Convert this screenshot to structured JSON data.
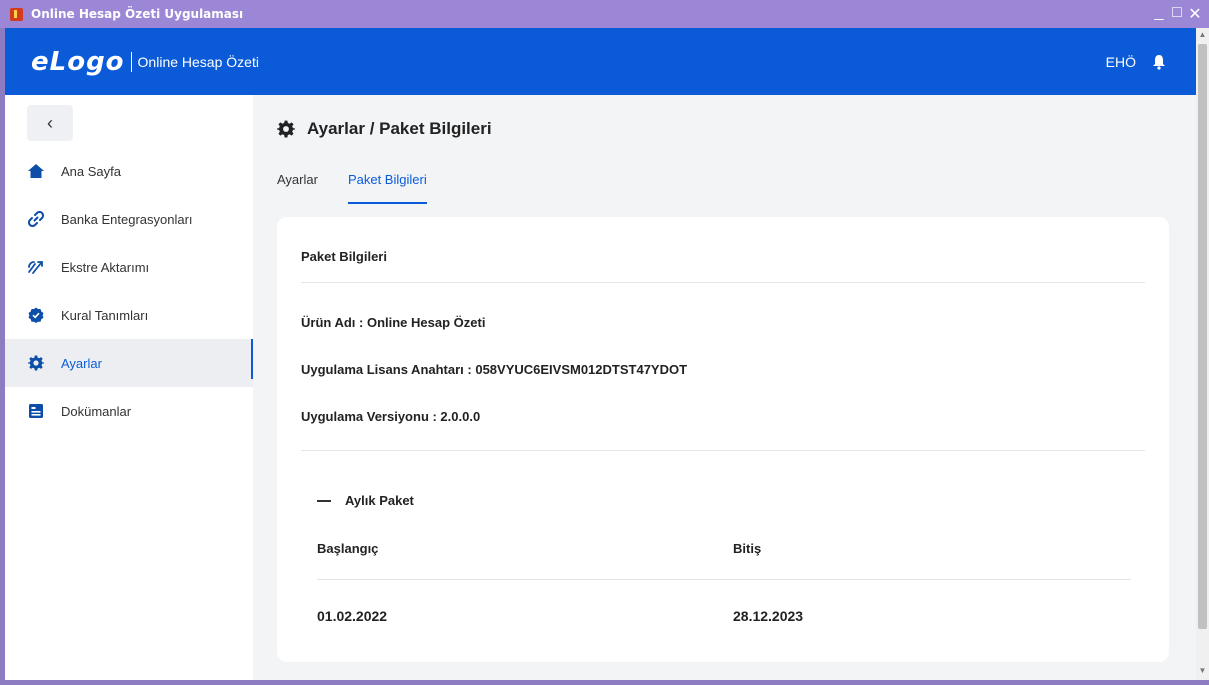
{
  "window": {
    "title": "Online Hesap Özeti Uygulaması"
  },
  "header": {
    "logo": "eLogo",
    "app_name": "Online Hesap Özeti",
    "user": "EHÖ"
  },
  "sidebar": {
    "items": [
      {
        "label": "Ana Sayfa",
        "icon": "home-icon"
      },
      {
        "label": "Banka Entegrasyonları",
        "icon": "link-icon"
      },
      {
        "label": "Ekstre Aktarımı",
        "icon": "transfer-icon"
      },
      {
        "label": "Kural Tanımları",
        "icon": "badge-check-icon"
      },
      {
        "label": "Ayarlar",
        "icon": "gear-icon",
        "active": true
      },
      {
        "label": "Dokümanlar",
        "icon": "document-icon"
      }
    ]
  },
  "page": {
    "title": "Ayarlar / Paket Bilgileri",
    "tabs": [
      {
        "label": "Ayarlar"
      },
      {
        "label": "Paket Bilgileri",
        "active": true
      }
    ]
  },
  "card": {
    "title": "Paket Bilgileri",
    "product_line": "Ürün Adı : Online Hesap Özeti",
    "license_line": "Uygulama Lisans Anahtarı : 058VYUC6EIVSM012DTST47YDOT",
    "version_line": "Uygulama Versiyonu : 2.0.0.0",
    "package": {
      "label": "Aylık Paket",
      "start_header": "Başlangıç",
      "end_header": "Bitiş",
      "start_value": "01.02.2022",
      "end_value": "28.12.2023"
    }
  },
  "colors": {
    "primary": "#0b5bd9",
    "titlebar": "#9b87d6"
  }
}
